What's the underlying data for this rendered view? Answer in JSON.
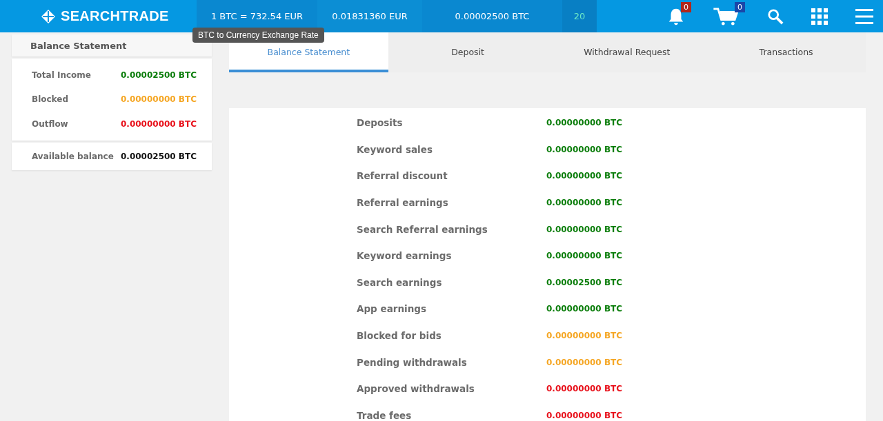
{
  "header": {
    "logo": "SEARCHTRADE",
    "rate": "1 BTC = 732.54 EUR",
    "rate_tooltip": "BTC to Currency Exchange Rate",
    "eur_balance": "0.01831360 EUR",
    "btc_balance": "0.00002500 BTC",
    "count": "20",
    "notifications": "0",
    "cart": "0"
  },
  "sidebar": {
    "title": "Balance Statement",
    "rows": [
      {
        "label": "Total Income",
        "value": "0.00002500 BTC",
        "color": "#0a7d0a"
      },
      {
        "label": "Blocked",
        "value": "0.00000000 BTC",
        "color": "#f5a623"
      },
      {
        "label": "Outflow",
        "value": "0.00000000 BTC",
        "color": "#e8101a"
      }
    ],
    "total": {
      "label": "Available balance",
      "value": "0.00002500 BTC"
    }
  },
  "tabs": [
    {
      "label": "Balance Statement",
      "selected": true
    },
    {
      "label": "Deposit",
      "selected": false
    },
    {
      "label": "Withdrawal Request",
      "selected": false
    },
    {
      "label": "Transactions",
      "selected": false
    }
  ],
  "statement": [
    {
      "label": "Deposits",
      "value": "0.00000000 BTC",
      "color": "#0a7d0a"
    },
    {
      "label": "Keyword sales",
      "value": "0.00000000 BTC",
      "color": "#0a7d0a"
    },
    {
      "label": "Referral discount",
      "value": "0.00000000 BTC",
      "color": "#0a7d0a"
    },
    {
      "label": "Referral earnings",
      "value": "0.00000000 BTC",
      "color": "#0a7d0a"
    },
    {
      "label": "Search Referral earnings",
      "value": "0.00000000 BTC",
      "color": "#0a7d0a"
    },
    {
      "label": "Keyword earnings",
      "value": "0.00000000 BTC",
      "color": "#0a7d0a"
    },
    {
      "label": "Search earnings",
      "value": "0.00002500 BTC",
      "color": "#0a7d0a"
    },
    {
      "label": "App earnings",
      "value": "0.00000000 BTC",
      "color": "#0a7d0a"
    },
    {
      "label": "Blocked for bids",
      "value": "0.00000000 BTC",
      "color": "#f5a623"
    },
    {
      "label": "Pending withdrawals",
      "value": "0.00000000 BTC",
      "color": "#f5a623"
    },
    {
      "label": "Approved withdrawals",
      "value": "0.00000000 BTC",
      "color": "#e8101a"
    },
    {
      "label": "Trade fees",
      "value": "0.00000000 BTC",
      "color": "#e8101a"
    }
  ]
}
